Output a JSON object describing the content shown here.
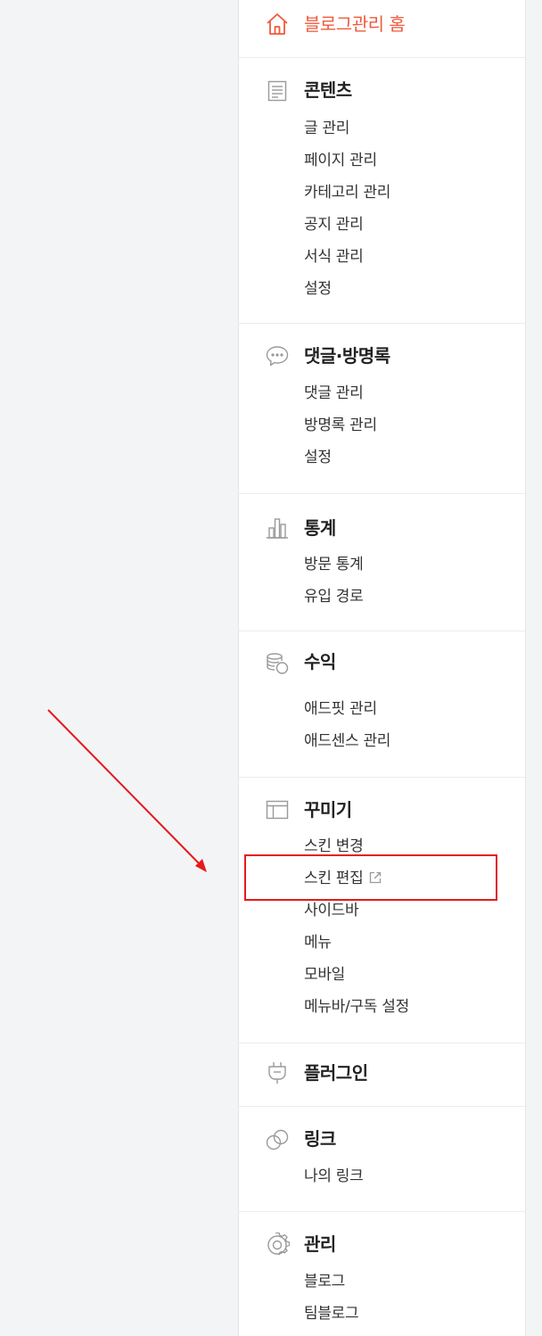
{
  "home": {
    "label": "블로그관리 홈",
    "icon": "home-icon",
    "color": "#ef5a3c"
  },
  "sections": [
    {
      "title": "콘텐츠",
      "icon": "document-icon",
      "items": [
        "글 관리",
        "페이지 관리",
        "카테고리 관리",
        "공지 관리",
        "서식 관리",
        "설정"
      ]
    },
    {
      "title": "댓글·방명록",
      "icon": "speech-bubble-icon",
      "items": [
        "댓글 관리",
        "방명록 관리",
        "설정"
      ]
    },
    {
      "title": "통계",
      "icon": "bar-chart-icon",
      "items": [
        "방문 통계",
        "유입 경로"
      ]
    },
    {
      "title": "수익",
      "icon": "coins-icon",
      "items": [
        "애드핏 관리",
        "애드센스 관리"
      ]
    },
    {
      "title": "꾸미기",
      "icon": "layout-icon",
      "items": [
        "스킨 변경",
        "스킨 편집",
        "사이드바",
        "메뉴",
        "모바일",
        "메뉴바/구독 설정"
      ]
    },
    {
      "title": "플러그인",
      "icon": "plug-icon",
      "items": []
    },
    {
      "title": "링크",
      "icon": "link-icon",
      "items": [
        "나의 링크"
      ]
    },
    {
      "title": "관리",
      "icon": "gear-icon",
      "items": [
        "블로그",
        "팀블로그"
      ]
    }
  ],
  "annotation": {
    "color": "#e41a1a",
    "target": "스킨 편집"
  }
}
